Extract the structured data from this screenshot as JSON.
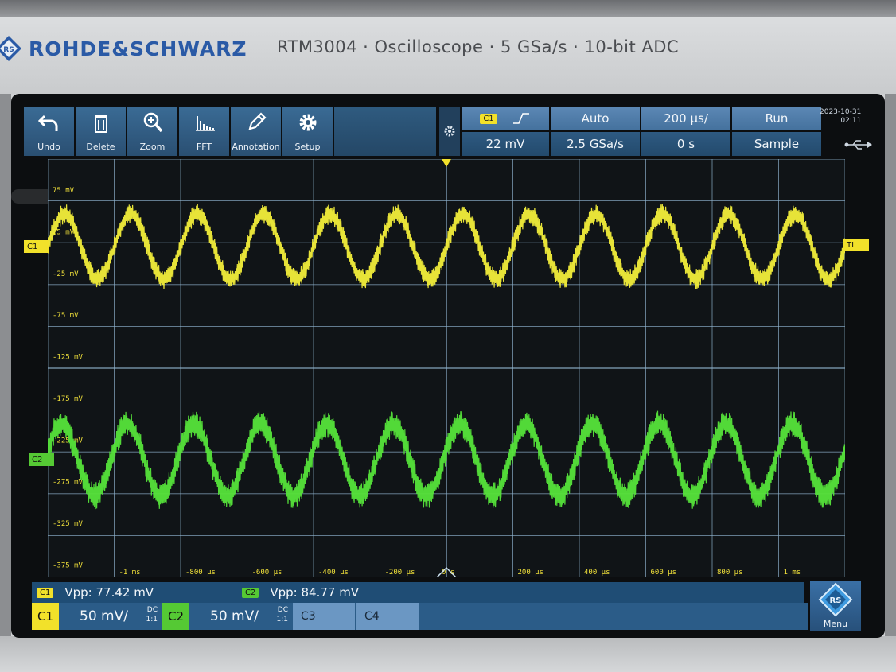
{
  "device": {
    "brand": "ROHDE&SCHWARZ",
    "model_line": "RTM3004 · Oscilloscope · 5 GSa/s · 10-bit ADC"
  },
  "toolbar": {
    "items": [
      {
        "label": "Undo",
        "icon": "undo-icon"
      },
      {
        "label": "Delete",
        "icon": "trash-icon"
      },
      {
        "label": "Zoom",
        "icon": "zoom-icon"
      },
      {
        "label": "FFT",
        "icon": "fft-icon"
      },
      {
        "label": "Annotation",
        "icon": "pencil-icon"
      },
      {
        "label": "Setup",
        "icon": "gear-icon"
      }
    ]
  },
  "acquisition": {
    "trigger_source": "C1",
    "trigger_slope": "rising-edge-icon",
    "trigger_level": "22 mV",
    "trigger_mode": "Auto",
    "sample_rate": "2.5 GSa/s",
    "time_scale": "200 µs/",
    "time_offset": "0 s",
    "run_state": "Run",
    "acq_mode": "Sample",
    "date": "2023-10-31",
    "time": "02:11"
  },
  "markers": {
    "c1": "C1",
    "c2": "C2",
    "trigger_level": "TL"
  },
  "chart_data": {
    "type": "line",
    "y_tick_labels": [
      "75 mV",
      "25 mV",
      "-25 mV",
      "-75 mV",
      "-125 mV",
      "-175 mV",
      "-225 mV",
      "-275 mV",
      "-325 mV",
      "-375 mV"
    ],
    "x_tick_labels": [
      "-1 ms",
      "-800 µs",
      "-600 µs",
      "-400 µs",
      "-200 µs",
      "0 s",
      "200 µs",
      "400 µs",
      "600 µs",
      "800 µs",
      "1 ms"
    ],
    "xlim": [
      -1.2,
      1.2
    ],
    "ylim": [
      -375,
      75
    ],
    "grid": true,
    "series": [
      {
        "name": "C1",
        "color": "#f3ee3a",
        "offset_mv": 0,
        "amplitude_mv": 38,
        "period_ms": 0.2,
        "noise_mv": 12
      },
      {
        "name": "C2",
        "color": "#56e43a",
        "offset_mv": -250,
        "amplitude_mv": 42,
        "period_ms": 0.2,
        "noise_mv": 16
      }
    ]
  },
  "measurements": {
    "c1_tag": "C1",
    "c1_text": "Vpp: 77.42 mV",
    "c2_tag": "C2",
    "c2_text": "Vpp: 84.77 mV"
  },
  "channels": [
    {
      "label": "C1",
      "scale": "50 mV/",
      "coupling": "DC",
      "ratio": "1:1",
      "color": "#f2e12a"
    },
    {
      "label": "C2",
      "scale": "50 mV/",
      "coupling": "DC",
      "ratio": "1:1",
      "color": "#55c934"
    },
    {
      "label": "C3"
    },
    {
      "label": "C4"
    }
  ],
  "menu": {
    "label": "Menu"
  }
}
